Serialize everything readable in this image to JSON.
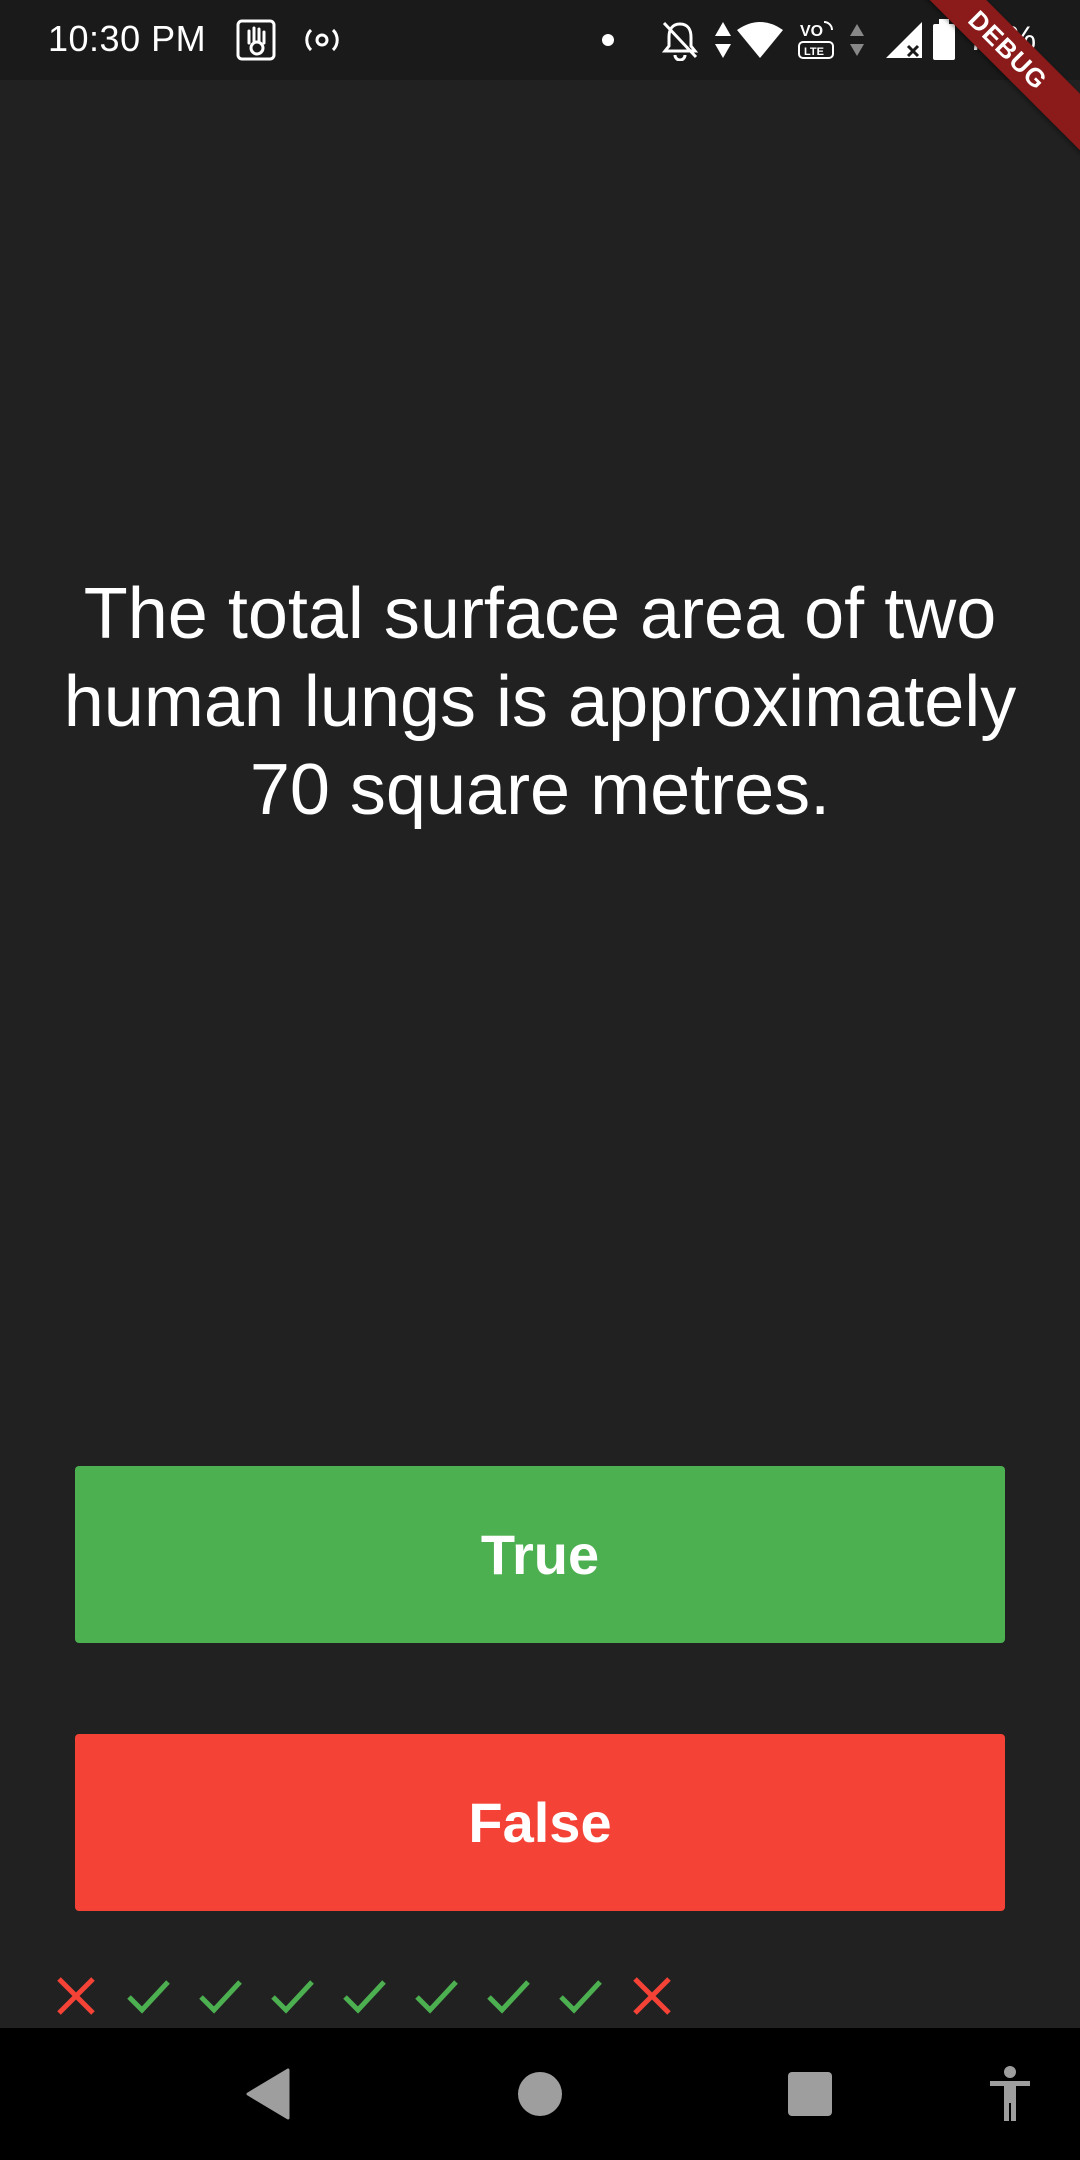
{
  "status_bar": {
    "time": "10:30 PM",
    "battery_percent": "77%",
    "icons": [
      "gesture-hand-icon",
      "hotspot-icon",
      "dot-icon",
      "bell-off-icon",
      "data-arrows-icon",
      "wifi-icon",
      "volte-icon",
      "signal-arrows-icon",
      "signal-icon",
      "battery-icon"
    ]
  },
  "debug_banner": "DEBUG",
  "quiz": {
    "question": "The total surface area of two human lungs is approximately 70 square metres.",
    "true_label": "True",
    "false_label": "False",
    "colors": {
      "true": "#4caf50",
      "false": "#f44336",
      "background": "#212121"
    }
  },
  "score_keeper": {
    "marks": [
      "wrong",
      "correct",
      "correct",
      "correct",
      "correct",
      "correct",
      "correct",
      "correct",
      "wrong"
    ],
    "colors": {
      "correct": "#4caf50",
      "wrong": "#f44336"
    }
  },
  "nav_bar": {
    "buttons": [
      "back-icon",
      "home-icon",
      "recents-icon",
      "accessibility-icon"
    ]
  }
}
